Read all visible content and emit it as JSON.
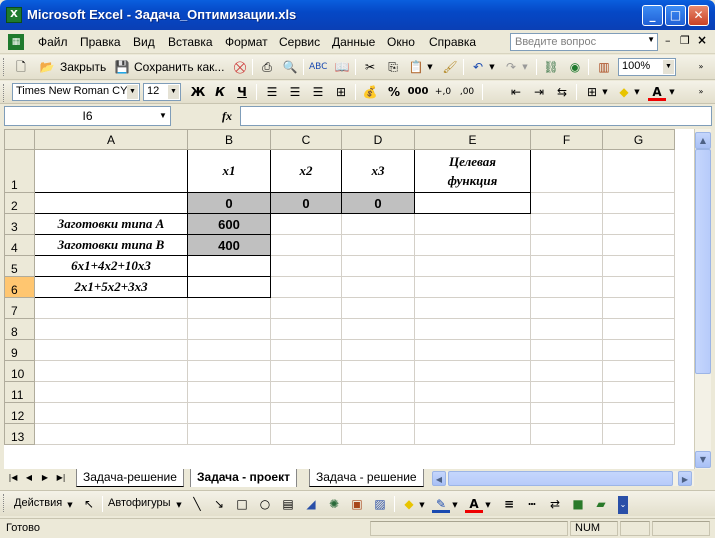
{
  "window": {
    "title": "Microsoft Excel - Задача_Оптимизации.xls",
    "buttons": {
      "minimize": "_",
      "maximize": "□",
      "close": "✕"
    }
  },
  "menu": {
    "items": [
      "Файл",
      "Правка",
      "Вид",
      "Вставка",
      "Формат",
      "Сервис",
      "Данные",
      "Окно",
      "Справка"
    ],
    "ask_placeholder": "Введите вопрос"
  },
  "standard_toolbar": {
    "close_label": "Закрыть",
    "save_as_label": "Сохранить как...",
    "zoom": "100%"
  },
  "format_toolbar": {
    "font": "Times New Roman CYR",
    "size": "12",
    "bold": "Ж",
    "italic": "К",
    "underline": "Ч",
    "percent": "%",
    "thousands": "000"
  },
  "formula_bar": {
    "name_box": "I6",
    "fx": "fx",
    "value": ""
  },
  "sheet": {
    "columns": [
      "A",
      "B",
      "C",
      "D",
      "E",
      "F",
      "G"
    ],
    "rows": [
      "1",
      "2",
      "3",
      "4",
      "5",
      "6",
      "7",
      "8",
      "9",
      "10",
      "11",
      "12",
      "13"
    ],
    "cells": {
      "B1": "x1",
      "C1": "x2",
      "D1": "x3",
      "E1_line1": "Целевая",
      "E1_line2": "функция",
      "B2": "0",
      "C2": "0",
      "D2": "0",
      "A3": "Заготовки типа А",
      "B3": "600",
      "A4": "Заготовки типа В",
      "B4": "400",
      "A5": "6x1+4x2+10x3",
      "A6": "2x1+5x2+3x3"
    },
    "selected_cell": "I6"
  },
  "tabs": [
    "Задача-решение",
    "Задача - проект",
    "Задача - решение"
  ],
  "active_tab": "Задача - проект",
  "drawing_toolbar": {
    "actions_label": "Действия",
    "autoshapes_label": "Автофигуры"
  },
  "status": {
    "text": "Готово",
    "num": "NUM"
  },
  "colors": {
    "title_bar": "#0A5FDE",
    "selected_header": "#FFC670",
    "gray_cell": "#C0C0C0"
  }
}
